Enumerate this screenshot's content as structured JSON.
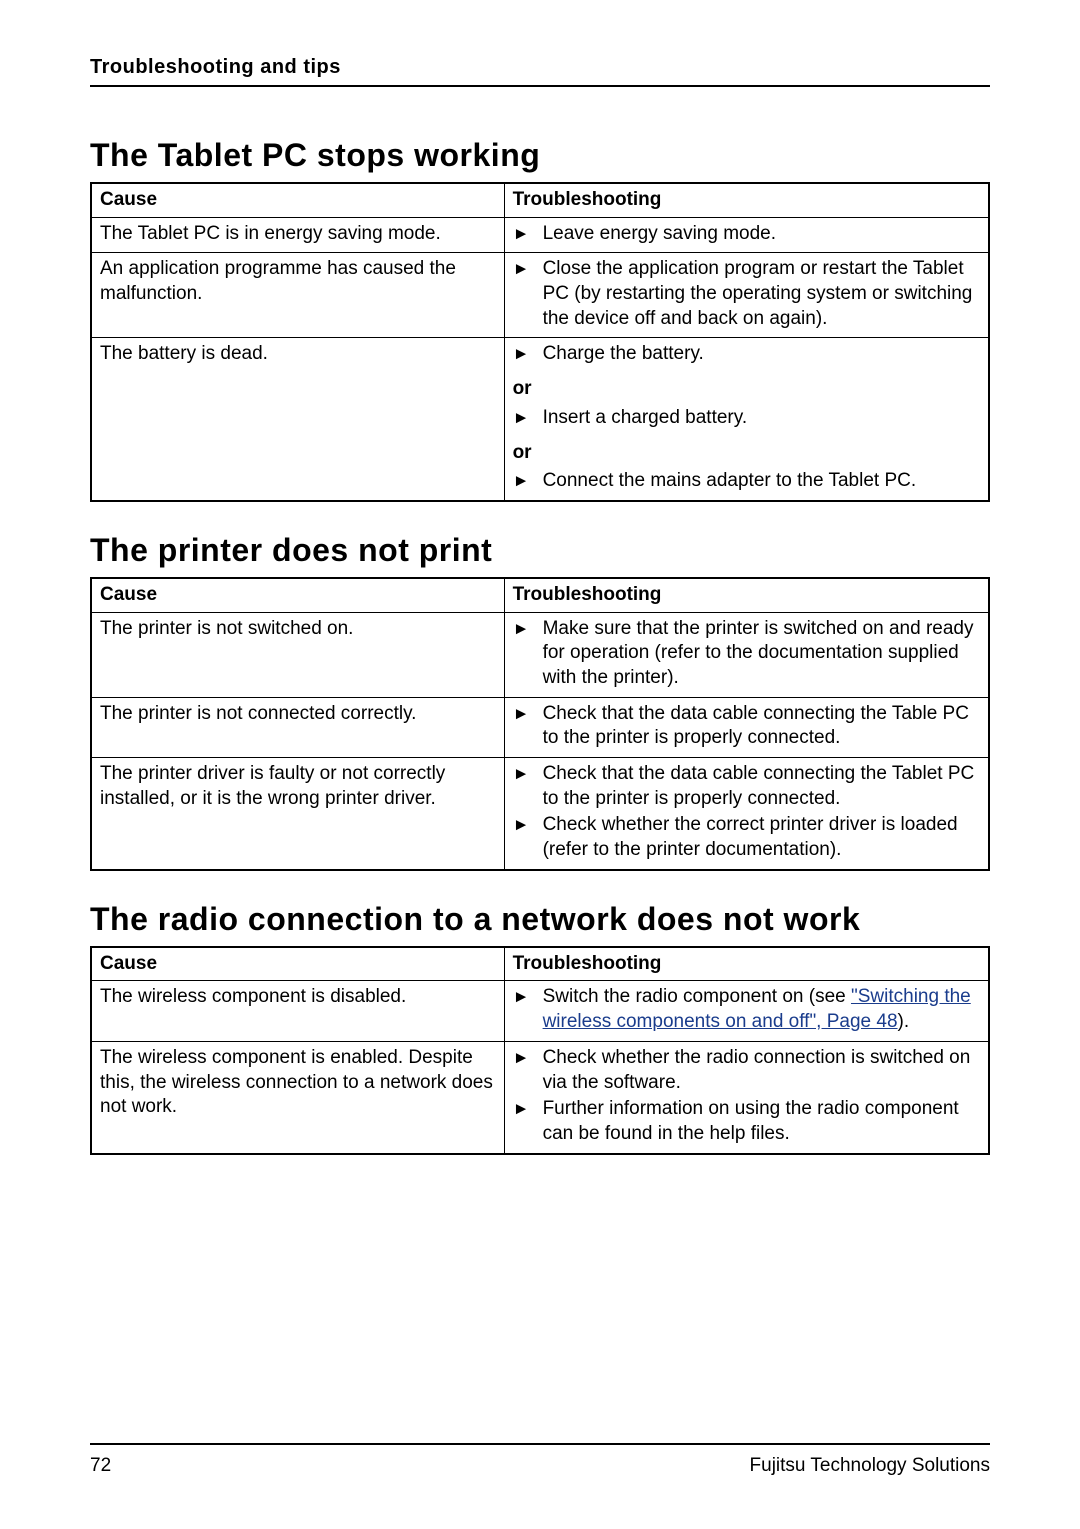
{
  "header": {
    "title": "Troubleshooting and tips"
  },
  "sections": [
    {
      "heading": "The Tablet PC stops working",
      "columns": {
        "cause": "Cause",
        "fix": "Troubleshooting"
      },
      "rows": [
        {
          "cause": "The Tablet PC is in energy saving mode.",
          "fix_items": [
            {
              "type": "action",
              "text": "Leave energy saving mode."
            }
          ]
        },
        {
          "cause": "An application programme has caused the malfunction.",
          "fix_items": [
            {
              "type": "action",
              "text": "Close the application program or restart the Tablet PC (by restarting the operating system or switching the device off and back on again)."
            }
          ]
        },
        {
          "cause": "The battery is dead.",
          "fix_items": [
            {
              "type": "action",
              "text": "Charge the battery."
            },
            {
              "type": "or",
              "text": "or"
            },
            {
              "type": "action_indent",
              "text": "Insert a charged battery."
            },
            {
              "type": "or",
              "text": "or"
            },
            {
              "type": "action_indent",
              "text": "Connect the mains adapter to the Tablet PC."
            }
          ]
        }
      ]
    },
    {
      "heading": "The printer does not print",
      "columns": {
        "cause": "Cause",
        "fix": "Troubleshooting"
      },
      "rows": [
        {
          "cause": "The printer is not switched on.",
          "fix_items": [
            {
              "type": "action",
              "text": "Make sure that the printer is switched on and ready for operation (refer to the documentation supplied with the printer)."
            }
          ]
        },
        {
          "cause": "The printer is not connected correctly.",
          "fix_items": [
            {
              "type": "action",
              "text": "Check that the data cable connecting the Table PC to the printer is properly connected."
            }
          ]
        },
        {
          "cause": "The printer driver is faulty or not correctly installed, or it is the wrong printer driver.",
          "fix_items": [
            {
              "type": "action",
              "text": "Check that the data cable connecting the Tablet PC to the printer is properly connected."
            },
            {
              "type": "action",
              "text": "Check whether the correct printer driver is loaded (refer to the printer documentation)."
            }
          ]
        }
      ]
    },
    {
      "heading": "The radio connection to a network does not work",
      "columns": {
        "cause": "Cause",
        "fix": "Troubleshooting"
      },
      "rows": [
        {
          "cause": "The wireless component is disabled.",
          "fix_items": [
            {
              "type": "action_with_link",
              "text_before": "Switch the radio component on (see ",
              "link_text": "\"Switching the wireless components on and off\", Page 48",
              "text_after": ")."
            }
          ]
        },
        {
          "cause": "The wireless component is enabled. Despite this, the wireless connection to a network does not work.",
          "fix_items": [
            {
              "type": "action",
              "text": "Check whether the radio connection is switched on via the software."
            },
            {
              "type": "action",
              "text": "Further information on using the radio component can be found in the help files."
            }
          ]
        }
      ]
    }
  ],
  "footer": {
    "page_number": "72",
    "brand": "Fujitsu Technology Solutions"
  },
  "glyphs": {
    "action_marker": "►"
  }
}
